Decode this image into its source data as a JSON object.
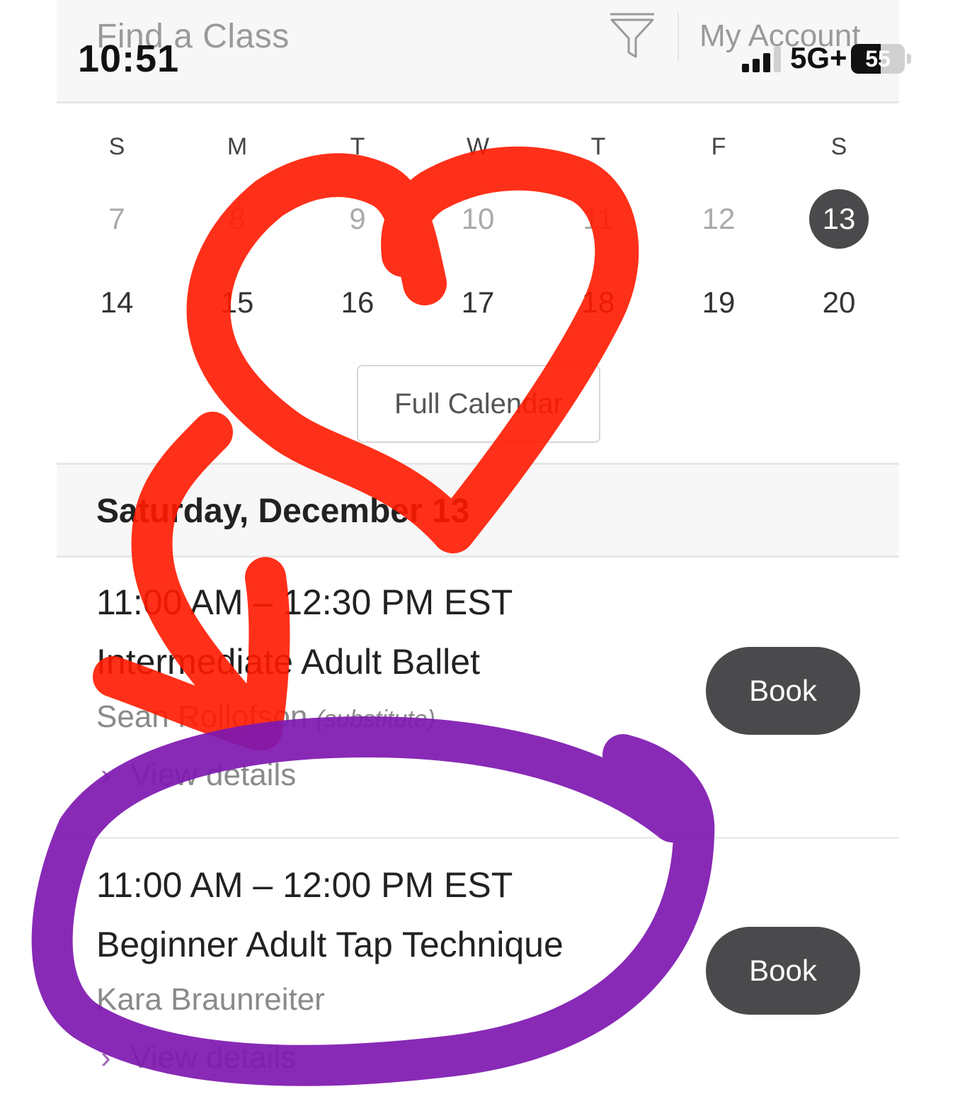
{
  "header": {
    "title": "Find a Class",
    "filter_icon": "filter-funnel-icon",
    "account_label": "My Account"
  },
  "status_bar": {
    "time": "10:51",
    "network": "5G+",
    "battery": "55"
  },
  "calendar": {
    "weekdays": [
      "S",
      "M",
      "T",
      "W",
      "T",
      "F",
      "S"
    ],
    "weeks": [
      [
        "7",
        "8",
        "9",
        "10",
        "11",
        "12",
        "13"
      ],
      [
        "14",
        "15",
        "16",
        "17",
        "18",
        "19",
        "20"
      ]
    ],
    "selected_day": "13",
    "full_calendar_label": "Full Calendar"
  },
  "schedule": {
    "date_heading": "Saturday, December 13",
    "classes": [
      {
        "time": "11:00 AM – 12:30 PM EST",
        "name": "Intermediate Adult Ballet",
        "instructor": "Sean Rollofson",
        "instructor_note": "(substitute)",
        "details_label": "View details",
        "book_label": "Book"
      },
      {
        "time": "11:00 AM – 12:00 PM EST",
        "name": "Beginner Adult Tap Technique",
        "instructor": "Kara Braunreiter",
        "details_label": "View details",
        "book_label": "Book"
      }
    ]
  },
  "colors": {
    "accent_dark": "#4a4a4c",
    "heart_annotation": "#ff1a00",
    "circle_annotation": "#7e18b0"
  }
}
